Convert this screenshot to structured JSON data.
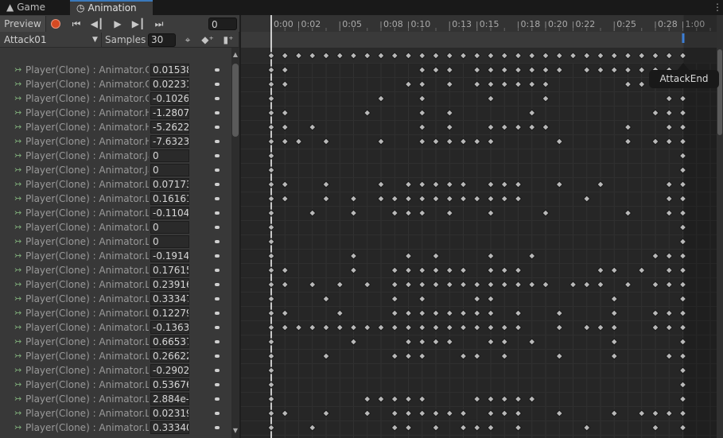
{
  "tabs": {
    "game": {
      "label": "Game",
      "icon": "gamepad-icon"
    },
    "animation": {
      "label": "Animation",
      "icon": "clock-icon"
    }
  },
  "toolbar": {
    "preview_label": "Preview",
    "frame_value": "0",
    "clip_name": "Attack01",
    "samples_label": "Samples",
    "samples_value": "30"
  },
  "event_tooltip": "AttackEnd",
  "time_ruler": [
    "0:00",
    "0:02",
    "0:05",
    "0:08",
    "0:10",
    "0:13",
    "0:15",
    "0:18",
    "0:20",
    "0:22",
    "0:25",
    "0:28",
    "1:00"
  ],
  "properties": [
    {
      "name": "Player(Clone) : Animator.Chest Front-Back",
      "value": "0.01538",
      "keys": [
        0,
        1,
        11,
        12,
        13,
        15,
        16,
        17,
        18,
        19,
        20,
        21,
        23,
        24,
        25,
        26,
        27,
        28,
        29,
        30
      ]
    },
    {
      "name": "Player(Clone) : Animator.Chest Left-Right",
      "value": "0.02231",
      "keys": [
        0,
        1,
        10,
        11,
        13,
        15,
        16,
        17,
        18,
        19,
        20,
        26,
        27,
        30
      ]
    },
    {
      "name": "Player(Clone) : Animator.Chest Twist",
      "value": "-0.1026",
      "keys": [
        0,
        8,
        11,
        16,
        20,
        29,
        30
      ]
    },
    {
      "name": "Player(Clone) : Animator.Head Nod",
      "value": "-1.2807",
      "keys": [
        0,
        1,
        7,
        11,
        13,
        19,
        28,
        29,
        30
      ]
    },
    {
      "name": "Player(Clone) : Animator.Head Tilt",
      "value": "-5.2622",
      "keys": [
        0,
        1,
        3,
        11,
        13,
        16,
        17,
        18,
        19,
        20,
        26,
        29,
        30
      ]
    },
    {
      "name": "Player(Clone) : Animator.Head Turn",
      "value": "-7.6323",
      "keys": [
        0,
        1,
        2,
        4,
        8,
        11,
        12,
        13,
        14,
        15,
        16,
        21,
        26,
        28,
        29,
        30
      ]
    },
    {
      "name": "Player(Clone) : Animator.Jaw Close",
      "value": "0",
      "keys": [
        0,
        30
      ]
    },
    {
      "name": "Player(Clone) : Animator.Jaw Left-Right",
      "value": "0",
      "keys": [
        0,
        30
      ]
    },
    {
      "name": "Player(Clone) : Animator.Left Arm Down-Up",
      "value": "0.07173",
      "keys": [
        0,
        1,
        4,
        8,
        10,
        11,
        12,
        13,
        14,
        16,
        17,
        18,
        21,
        24,
        29,
        30
      ]
    },
    {
      "name": "Player(Clone) : Animator.Left Arm Front-Back",
      "value": "0.16161",
      "keys": [
        0,
        1,
        4,
        6,
        8,
        9,
        10,
        11,
        12,
        13,
        14,
        15,
        16,
        17,
        18,
        23,
        29,
        30
      ]
    },
    {
      "name": "Player(Clone) : Animator.Left Arm Twist In-Out",
      "value": "-0.1104",
      "keys": [
        0,
        3,
        6,
        9,
        10,
        11,
        13,
        16,
        20,
        26,
        29,
        30
      ]
    },
    {
      "name": "Player(Clone) : Animator.Left Eye Down-Up",
      "value": "0",
      "keys": [
        0,
        30
      ]
    },
    {
      "name": "Player(Clone) : Animator.Left Eye In-Out",
      "value": "0",
      "keys": [
        0,
        30
      ]
    },
    {
      "name": "Player(Clone) : Animator.Left Foot Twist In-Out",
      "value": "-0.1914",
      "keys": [
        0,
        6,
        10,
        12,
        16,
        19,
        28,
        29,
        30
      ]
    },
    {
      "name": "Player(Clone) : Animator.Left Foot Up-Down",
      "value": "0.17615",
      "keys": [
        0,
        1,
        6,
        9,
        10,
        11,
        12,
        13,
        14,
        16,
        17,
        18,
        24,
        25,
        27,
        29,
        30
      ]
    },
    {
      "name": "Player(Clone) : Animator.Left Forearm Stretch",
      "value": "0.23916",
      "keys": [
        0,
        1,
        3,
        5,
        7,
        9,
        10,
        11,
        12,
        13,
        14,
        15,
        16,
        17,
        18,
        19,
        20,
        22,
        23,
        24,
        26,
        28,
        29,
        30
      ]
    },
    {
      "name": "Player(Clone) : Animator.Left Forearm Twist In-Out",
      "value": "0.33347",
      "keys": [
        0,
        4,
        9,
        11,
        15,
        16,
        25,
        30
      ]
    },
    {
      "name": "Player(Clone) : Animator.Left Hand Down-Up",
      "value": "0.12279",
      "keys": [
        0,
        1,
        5,
        9,
        10,
        11,
        12,
        13,
        14,
        15,
        16,
        18,
        21,
        25,
        28,
        29,
        30
      ]
    },
    {
      "name": "Player(Clone) : Animator.Left Hand In-Out",
      "value": "-0.1363",
      "keys": [
        0,
        1,
        2,
        3,
        4,
        5,
        6,
        7,
        8,
        9,
        10,
        11,
        12,
        13,
        14,
        15,
        16,
        17,
        18,
        21,
        23,
        24,
        25,
        28,
        29,
        30
      ]
    },
    {
      "name": "Player(Clone) : Animator.Left Lower Leg Stretch",
      "value": "0.66537",
      "keys": [
        0,
        6,
        10,
        11,
        12,
        13,
        16,
        17,
        19,
        25,
        30
      ]
    },
    {
      "name": "Player(Clone) : Animator.Left Lower Leg Twist In-Out",
      "value": "0.26622",
      "keys": [
        0,
        4,
        9,
        10,
        11,
        14,
        15,
        17,
        21,
        25,
        29,
        30
      ]
    },
    {
      "name": "Player(Clone) : Animator.Left Shoulder Down-Up",
      "value": "-0.2902",
      "keys": [
        0,
        30
      ]
    },
    {
      "name": "Player(Clone) : Animator.Left Shoulder Front-Back",
      "value": "0.53676",
      "keys": [
        0,
        30
      ]
    },
    {
      "name": "Player(Clone) : Animator.Left Thumb 1 Stretched",
      "value": "2.884e-",
      "keys": [
        0,
        7,
        8,
        9,
        10,
        11,
        15,
        16,
        17,
        18,
        19,
        30
      ]
    },
    {
      "name": "Player(Clone) : Animator.Left Thumb 2 Stretched",
      "value": "0.02319",
      "keys": [
        0,
        1,
        4,
        7,
        9,
        10,
        11,
        12,
        13,
        14,
        16,
        17,
        18,
        21,
        25,
        27,
        28,
        29,
        30
      ]
    },
    {
      "name": "Player(Clone) : Animator.Left Thumb 3 Stretched",
      "value": "0.33340",
      "keys": [
        0,
        3,
        9,
        10,
        12,
        14,
        15,
        16,
        18,
        23,
        28,
        30
      ]
    }
  ],
  "summary_keys": [
    0,
    1,
    2,
    3,
    4,
    5,
    6,
    7,
    8,
    9,
    10,
    11,
    12,
    13,
    14,
    15,
    16,
    17,
    18,
    19,
    20,
    21,
    22,
    23,
    24,
    25,
    26,
    27,
    28,
    29,
    30
  ]
}
